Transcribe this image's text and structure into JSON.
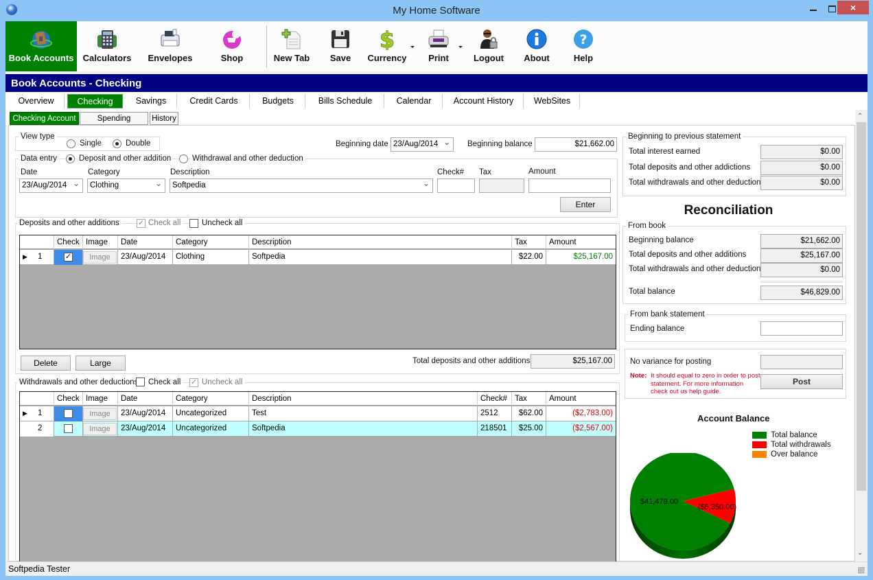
{
  "window": {
    "title": "My Home Software",
    "minimize": "minimize",
    "maximize": "maximize",
    "close": "×"
  },
  "toolbar": {
    "items": [
      {
        "label": "Book Accounts",
        "icon": "book-accounts-icon",
        "active": true
      },
      {
        "label": "Calculators",
        "icon": "calculator-icon"
      },
      {
        "label": "Envelopes",
        "icon": "envelopes-icon"
      },
      {
        "label": "Shop",
        "icon": "shop-icon"
      },
      {
        "label": "New Tab",
        "icon": "new-tab-icon"
      },
      {
        "label": "Save",
        "icon": "floppy-disk-icon"
      },
      {
        "label": "Currency",
        "icon": "dollar-icon",
        "dropdown": true
      },
      {
        "label": "Print",
        "icon": "printer-icon",
        "dropdown": true
      },
      {
        "label": "Logout",
        "icon": "user-lock-icon"
      },
      {
        "label": "About",
        "icon": "info-icon"
      },
      {
        "label": "Help",
        "icon": "help-icon"
      }
    ]
  },
  "header": {
    "title": "Book Accounts - Checking"
  },
  "tabs": [
    "Overview",
    "Checking",
    "Savings",
    "Credit Cards",
    "Budgets",
    "Bills Schedule",
    "Calendar",
    "Account History",
    "WebSites"
  ],
  "active_tab": "Checking",
  "subtabs": [
    "Checking Account",
    "Spending Categries",
    "History"
  ],
  "view_type": {
    "label": "View type",
    "options": [
      "Single",
      "Double"
    ],
    "selected": "Double"
  },
  "beginning": {
    "date_label": "Beginning date",
    "date": "23/Aug/2014",
    "balance_label": "Beginning balance",
    "balance": "$21,662.00"
  },
  "data_entry": {
    "label": "Data entry",
    "modes": [
      "Deposit and other addition",
      "Withdrawal and other deduction"
    ],
    "selected_mode": "Deposit and other addition",
    "fields": {
      "date_label": "Date",
      "date": "23/Aug/2014",
      "category_label": "Category",
      "category": "Clothing",
      "description_label": "Description",
      "description": "Softpedia",
      "check_label": "Check#",
      "check": "",
      "tax_label": "Tax",
      "tax": "",
      "amount_label": "Amount",
      "amount": ""
    },
    "enter_label": "Enter"
  },
  "deposits": {
    "label": "Deposits and other additions",
    "check_all": "Check all",
    "uncheck_all": "Uncheck all",
    "columns": [
      "Check",
      "Image",
      "Date",
      "Category",
      "Description",
      "Tax",
      "Amount"
    ],
    "rows": [
      {
        "num": "1",
        "checked": true,
        "image": "Image",
        "date": "23/Aug/2014",
        "category": "Clothing",
        "description": "Softpedia",
        "tax": "$22.00",
        "amount": "$25,167.00"
      }
    ],
    "delete_label": "Delete",
    "large_label": "Large",
    "total_label": "Total deposits  and other additions",
    "total": "$25,167.00"
  },
  "withdrawals": {
    "label": "Withdrawals  and other deductions",
    "check_all": "Check all",
    "uncheck_all": "Uncheck all",
    "columns": [
      "Check",
      "Image",
      "Date",
      "Category",
      "Description",
      "Check#",
      "Tax",
      "Amount"
    ],
    "rows": [
      {
        "num": "1",
        "checked": false,
        "image": "Image",
        "date": "23/Aug/2014",
        "category": "Uncategorized",
        "description": "Test",
        "check": "2512",
        "tax": "$62.00",
        "amount": "($2,783.00)"
      },
      {
        "num": "2",
        "checked": false,
        "image": "Image",
        "date": "23/Aug/2014",
        "category": "Uncategorized",
        "description": "Softpedia",
        "check": "218501",
        "tax": "$25.00",
        "amount": "($2,567.00)"
      }
    ]
  },
  "previous_statement": {
    "label": "Beginning to previous statement",
    "rows": [
      {
        "label": "Total interest earned",
        "value": "$0.00"
      },
      {
        "label": "Total deposits and other addictions",
        "value": "$0.00"
      },
      {
        "label": "Total withdrawals and other deductions",
        "value": "$0.00"
      }
    ]
  },
  "reconciliation": {
    "title": "Reconciliation",
    "from_book": "From book",
    "rows": [
      {
        "label": "Beginning balance",
        "value": "$21,662.00"
      },
      {
        "label": "Total deposits and other additions",
        "value": "$25,167.00"
      },
      {
        "label": "Total withdrawals and other deductions",
        "value": "$0.00"
      }
    ],
    "total_label": "Total balance",
    "total": "$46,829.00",
    "from_bank": "From bank statement",
    "ending_label": "Ending balance",
    "ending": "",
    "variance_label": "No variance for posting",
    "variance": "",
    "note_label": "Note:",
    "note": "It should equal to zero in order to post statement. For more information check out us help guide.",
    "post_label": "Post"
  },
  "chart_data": {
    "type": "pie",
    "title": "Account Balance",
    "legend": [
      "Total balance",
      "Total withdrawals",
      "Over balance"
    ],
    "legend_position": "top-right",
    "slices": [
      {
        "name": "Total balance",
        "value": 41479.0,
        "label": "$41,479.00",
        "color": "#008000"
      },
      {
        "name": "Total withdrawals",
        "value": 5350.0,
        "label": "($5,350.00)",
        "color": "#ff0000"
      },
      {
        "name": "Over balance",
        "value": 0,
        "label": "",
        "color": "#ff8000"
      }
    ]
  },
  "status": {
    "user": "Softpedia Tester"
  },
  "colors": {
    "accent_green": "#008000",
    "header_navy": "#000080",
    "positive_amount": "#008000",
    "negative_amount": "#e00000",
    "selected_row": "#bfffff"
  }
}
